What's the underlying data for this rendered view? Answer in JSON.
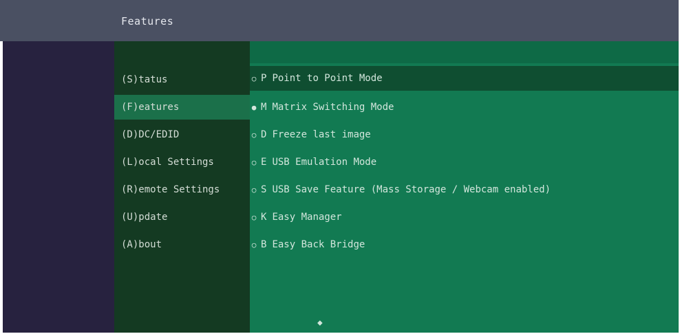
{
  "header": {
    "title": "Features"
  },
  "menu": {
    "items": [
      {
        "label": "(S)tatus",
        "active": false
      },
      {
        "label": "(F)eatures",
        "active": true
      },
      {
        "label": "(D)DC/EDID",
        "active": false
      },
      {
        "label": "(L)ocal  Settings",
        "active": false
      },
      {
        "label": "(R)emote Settings",
        "active": false
      },
      {
        "label": "(U)pdate",
        "active": false
      },
      {
        "label": "(A)bout",
        "active": false
      }
    ]
  },
  "features": {
    "options": [
      {
        "bullet": "○",
        "hotkey": "P",
        "label": "Point to Point Mode",
        "selected": false,
        "highlighted": true
      },
      {
        "bullet": "●",
        "hotkey": "M",
        "label": "Matrix Switching Mode",
        "selected": true,
        "highlighted": false
      },
      {
        "bullet": "○",
        "hotkey": "D",
        "label": "Freeze last image",
        "selected": false,
        "highlighted": false
      },
      {
        "bullet": "○",
        "hotkey": "E",
        "label": "USB Emulation Mode",
        "selected": false,
        "highlighted": false
      },
      {
        "bullet": "○",
        "hotkey": "S",
        "label": "USB Save Feature (Mass Storage / Webcam enabled)",
        "selected": false,
        "highlighted": false
      },
      {
        "bullet": "○",
        "hotkey": "K",
        "label": "Easy Manager",
        "selected": false,
        "highlighted": false
      },
      {
        "bullet": "○",
        "hotkey": "B",
        "label": "Easy Back Bridge",
        "selected": false,
        "highlighted": false
      }
    ],
    "scroll_indicator": "⬥"
  },
  "colors": {
    "header_bg": "#4a5062",
    "menu_bg": "#143a22",
    "menu_active_bg": "#1b704a",
    "content_bg": "#127a52",
    "highlight_bg": "#0f4e31",
    "margin_bg": "#27223f"
  }
}
